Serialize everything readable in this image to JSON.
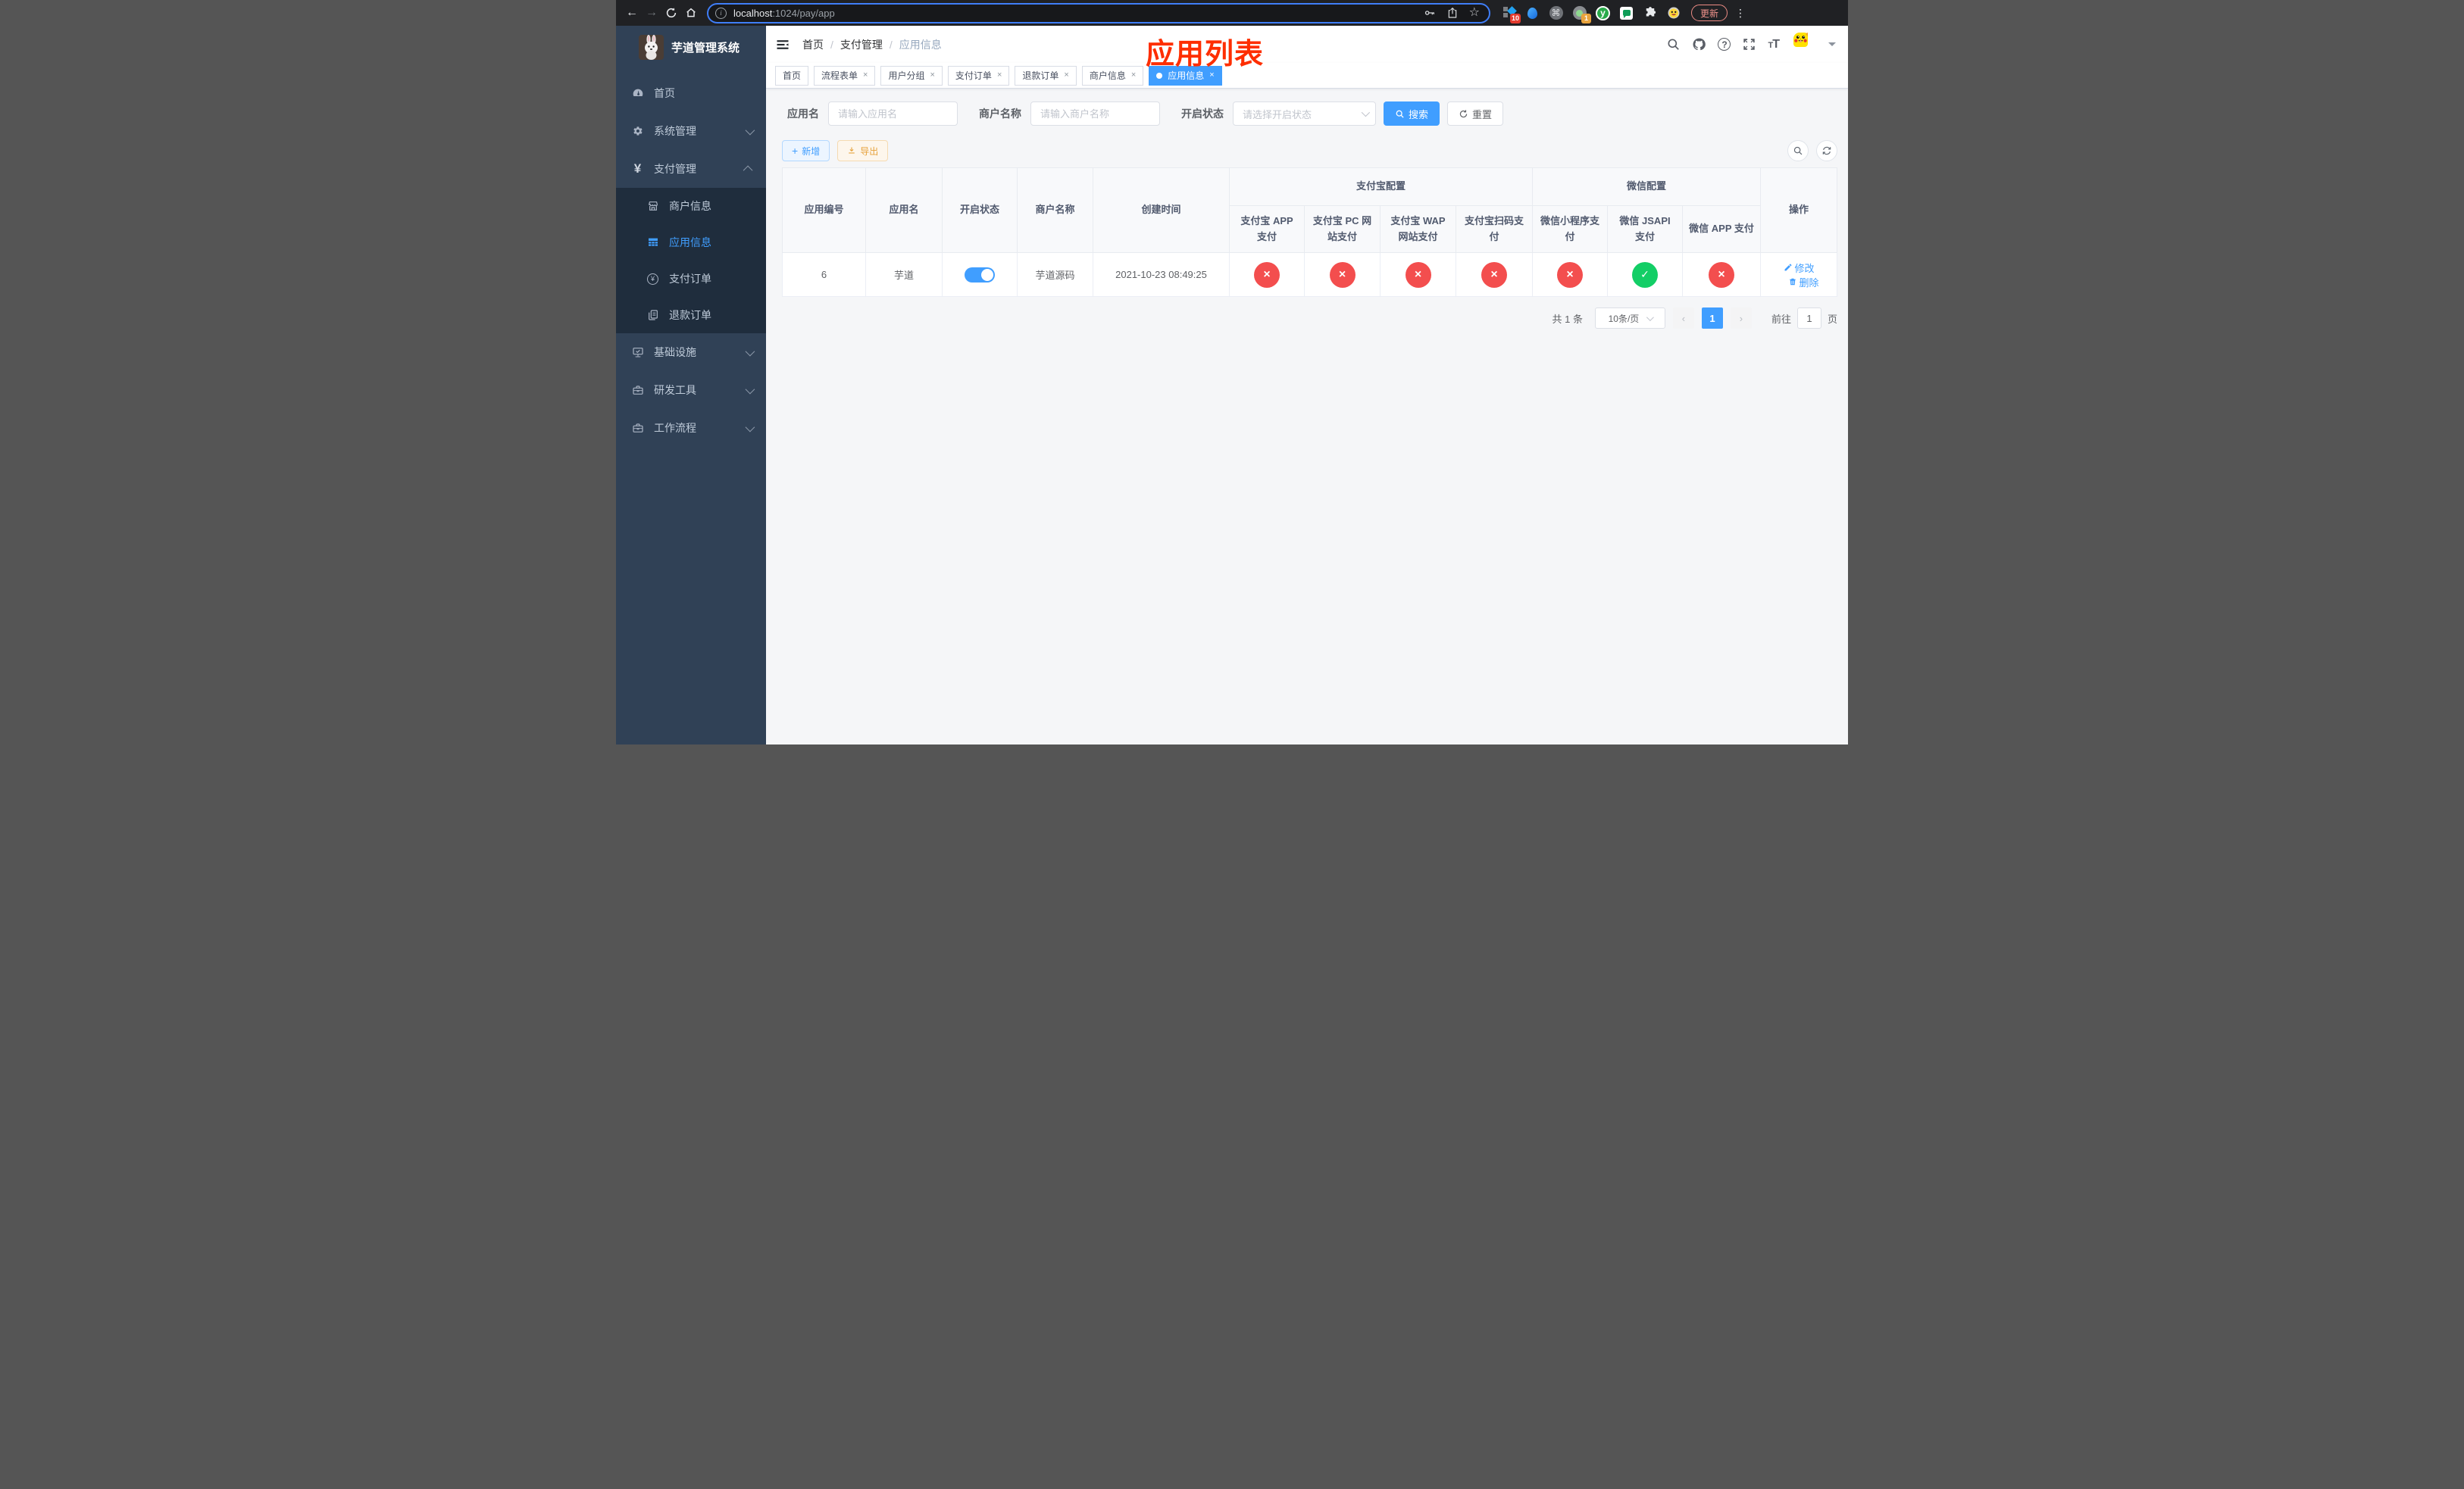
{
  "colors": {
    "primary": "#409eff",
    "success": "#13ce66",
    "danger": "#f34e4e",
    "annotation": "#fe2e00"
  },
  "browser": {
    "url_host": "localhost",
    "url_path": ":1024/pay/app",
    "update_label": "更新",
    "ext_badge_tag": "10",
    "ext_badge_rec": "1",
    "ext_y_label": "y",
    "cmd_glyph": "⌘"
  },
  "sidebar": {
    "logo_title": "芋道管理系统",
    "menu": [
      {
        "label": "首页"
      },
      {
        "label": "系统管理"
      },
      {
        "label": "支付管理"
      },
      {
        "label": "商户信息"
      },
      {
        "label": "应用信息"
      },
      {
        "label": "支付订单"
      },
      {
        "label": "退款订单"
      },
      {
        "label": "基础设施"
      },
      {
        "label": "研发工具"
      },
      {
        "label": "工作流程"
      }
    ]
  },
  "header": {
    "breadcrumb": [
      "首页",
      "支付管理",
      "应用信息"
    ],
    "annotation": "应用列表"
  },
  "tabs": [
    {
      "label": "首页"
    },
    {
      "label": "流程表单"
    },
    {
      "label": "用户分组"
    },
    {
      "label": "支付订单"
    },
    {
      "label": "退款订单"
    },
    {
      "label": "商户信息"
    },
    {
      "label": "应用信息"
    }
  ],
  "filters": {
    "app_name": {
      "label": "应用名",
      "placeholder": "请输入应用名"
    },
    "merchant": {
      "label": "商户名称",
      "placeholder": "请输入商户名称"
    },
    "status": {
      "label": "开启状态",
      "placeholder": "请选择开启状态"
    },
    "search_label": "搜索",
    "reset_label": "重置"
  },
  "toolbar": {
    "add_label": "新增",
    "export_label": "导出"
  },
  "table": {
    "columns": {
      "app_id": "应用编号",
      "app_name": "应用名",
      "status": "开启状态",
      "merchant": "商户名称",
      "created": "创建时间",
      "alipay_group": "支付宝配置",
      "wechat_group": "微信配置",
      "op": "操作"
    },
    "channel_columns": [
      "支付宝 APP 支付",
      "支付宝 PC 网站支付",
      "支付宝 WAP 网站支付",
      "支付宝扫码支付",
      "微信小程序支付",
      "微信 JSAPI 支付",
      "微信 APP 支付"
    ],
    "row": {
      "app_id": "6",
      "app_name": "芋道",
      "status": "on",
      "merchant": "芋道源码",
      "created": "2021-10-23 08:49:25",
      "channels": [
        "off",
        "off",
        "off",
        "off",
        "off",
        "on",
        "off"
      ],
      "edit_label": "修改",
      "delete_label": "删除"
    }
  },
  "pagination": {
    "total_text": "共 1 条",
    "page_size": "10条/页",
    "current_page": "1",
    "goto_label": "前往",
    "goto_value": "1",
    "page_unit": "页"
  }
}
